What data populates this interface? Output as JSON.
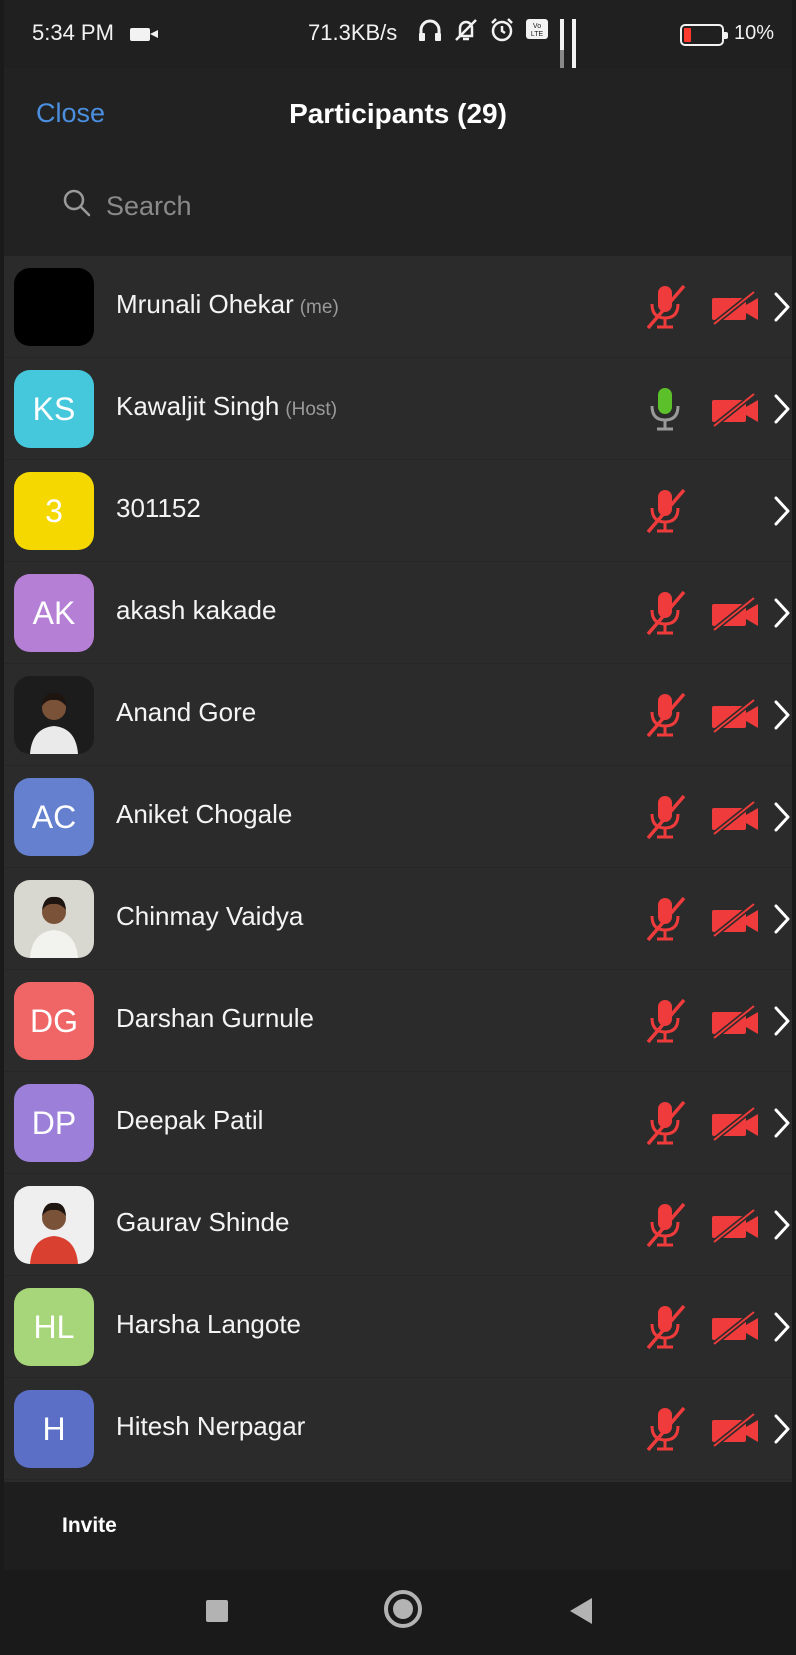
{
  "status_bar": {
    "time": "5:34 PM",
    "speed": "71.3KB/s",
    "battery_pct": "10%",
    "icons": [
      "video-recording-icon",
      "headphones-icon",
      "vibrate-off-icon",
      "alarm-icon",
      "volte-icon",
      "signal-4g-icon",
      "signal-icon",
      "battery-low-icon"
    ]
  },
  "header": {
    "close_label": "Close",
    "title": "Participants (29)"
  },
  "search": {
    "placeholder": "Search",
    "value": ""
  },
  "participants": [
    {
      "name": "Mrunali Ohekar",
      "tag": "(me)",
      "avatar_type": "photo-dark",
      "initials": "",
      "color": "#000000",
      "mic": "muted",
      "video": "off"
    },
    {
      "name": "Kawaljit Singh",
      "tag": "(Host)",
      "avatar_type": "initials",
      "initials": "KS",
      "color": "#45c8dc",
      "mic": "on",
      "video": "off"
    },
    {
      "name": "301152",
      "tag": "",
      "avatar_type": "initials",
      "initials": "3",
      "color": "#f5d800",
      "mic": "muted",
      "video": "none"
    },
    {
      "name": "akash kakade",
      "tag": "",
      "avatar_type": "initials",
      "initials": "AK",
      "color": "#b57fd6",
      "mic": "muted",
      "video": "off"
    },
    {
      "name": "Anand Gore",
      "tag": "",
      "avatar_type": "photo",
      "initials": "",
      "color": "#1c1c1c",
      "mic": "muted",
      "video": "off"
    },
    {
      "name": "Aniket Chogale",
      "tag": "",
      "avatar_type": "initials",
      "initials": "AC",
      "color": "#6480cf",
      "mic": "muted",
      "video": "off"
    },
    {
      "name": "Chinmay Vaidya",
      "tag": "",
      "avatar_type": "photo",
      "initials": "",
      "color": "#d8d8d0",
      "mic": "muted",
      "video": "off"
    },
    {
      "name": "Darshan Gurnule",
      "tag": "",
      "avatar_type": "initials",
      "initials": "DG",
      "color": "#f06565",
      "mic": "muted",
      "video": "off"
    },
    {
      "name": "Deepak Patil",
      "tag": "",
      "avatar_type": "initials",
      "initials": "DP",
      "color": "#9b7fd9",
      "mic": "muted",
      "video": "off"
    },
    {
      "name": "Gaurav Shinde",
      "tag": "",
      "avatar_type": "photo",
      "initials": "",
      "color": "#efefef",
      "mic": "muted",
      "video": "off"
    },
    {
      "name": "Harsha Langote",
      "tag": "",
      "avatar_type": "initials",
      "initials": "HL",
      "color": "#a6d57a",
      "mic": "muted",
      "video": "off"
    },
    {
      "name": "Hitesh Nerpagar",
      "tag": "",
      "avatar_type": "initials",
      "initials": "H",
      "color": "#5b6fc6",
      "mic": "muted",
      "video": "off"
    }
  ],
  "footer": {
    "invite_label": "Invite"
  },
  "nav": {
    "icons": [
      "recents-square-icon",
      "home-circle-icon",
      "back-triangle-icon"
    ]
  }
}
